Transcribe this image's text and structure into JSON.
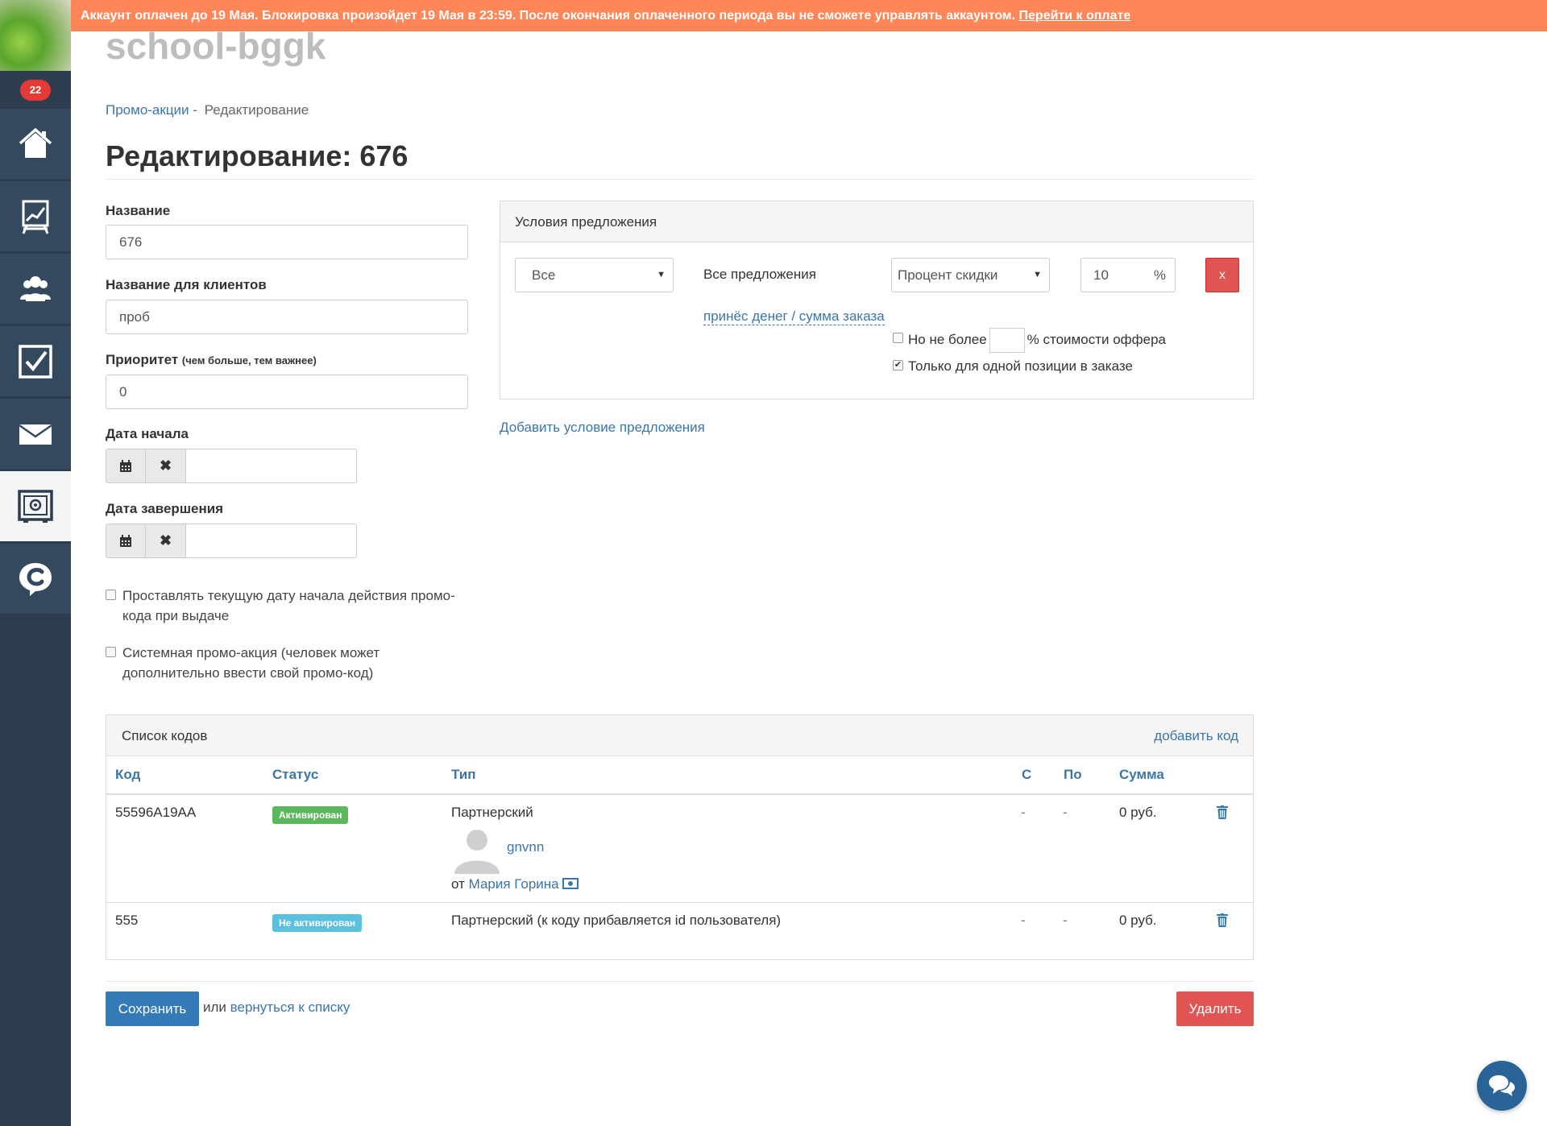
{
  "banner": {
    "text": "Аккаунт оплачен до 19 Мая. Блокировка произойдет 19 Мая в 23:59. После окончания оплаченного периода вы не сможете управлять аккаунтом. ",
    "link": "Перейти к оплате"
  },
  "sidebar": {
    "badge": "22",
    "items": [
      {
        "icon": "home-icon"
      },
      {
        "icon": "chart-board-icon"
      },
      {
        "icon": "users-icon"
      },
      {
        "icon": "checkbox-icon"
      },
      {
        "icon": "mail-icon"
      },
      {
        "icon": "safe-icon",
        "active": true
      },
      {
        "icon": "chat-c-icon"
      }
    ]
  },
  "app_title": "school-bggk",
  "breadcrumb": {
    "link": "Промо-акции",
    "sep": " - ",
    "current": "Редактирование"
  },
  "page_title": "Редактирование: 676",
  "form": {
    "name_label": "Название",
    "name_value": "676",
    "client_name_label": "Название для клиентов",
    "client_name_value": "проб",
    "priority_label": "Приоритет",
    "priority_hint": "(чем больше, тем важнее)",
    "priority_value": "0",
    "start_label": "Дата начала",
    "end_label": "Дата завершения",
    "check1_label": "Проставлять текущую дату начала действия промо-кода при выдаче",
    "check2_label": "Системная промо-акция (человек может дополнительно ввести свой промо-код)"
  },
  "conditions": {
    "title": "Условия предложения",
    "scope_select": "Все",
    "offers_text": "Все предложения",
    "type_select": "Процент скидки",
    "value": "10",
    "unit": "%",
    "remove_label": "x",
    "link": "принёс денег / сумма заказа",
    "limit_prefix": "Но не более",
    "limit_suffix": "% стоимости оффера",
    "single_position": "Только для одной позиции в заказе",
    "single_checked": true,
    "add_label": "Добавить условие предложения"
  },
  "codes": {
    "title": "Список кодов",
    "add_label": "добавить код",
    "columns": [
      "Код",
      "Статус",
      "Тип",
      "С",
      "По",
      "Сумма"
    ],
    "rows": [
      {
        "code": "55596A19AA",
        "status": "Активирован",
        "status_color": "#5cb85c",
        "type": "Партнерский",
        "partner": "gnvnn",
        "from_prefix": "от",
        "from_user": "Мария Горина",
        "from": "-",
        "to": "-",
        "sum": "0 руб."
      },
      {
        "code": "555",
        "status": "Не активирован",
        "status_color": "#5bc0de",
        "type": "Партнерский (к коду прибавляется id пользователя)",
        "from": "-",
        "to": "-",
        "sum": "0 руб."
      }
    ]
  },
  "actions": {
    "save": "Сохранить",
    "or": "или",
    "back": "вернуться к списку",
    "delete": "Удалить"
  },
  "colors": {
    "accent": "#337ab7",
    "danger": "#e05554",
    "banner": "#fe8659",
    "sidebar": "#2c3e50"
  }
}
